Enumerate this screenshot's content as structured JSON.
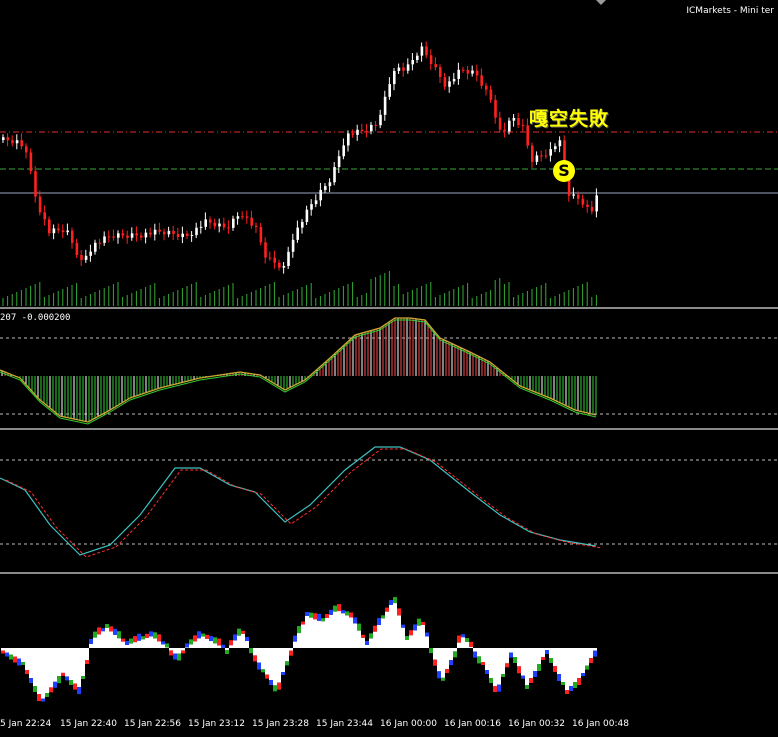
{
  "window": {
    "broker_label": "ICMarkets - Mini ter"
  },
  "indicator": {
    "macd_label": "207 -0.000200"
  },
  "annotation": {
    "text": "嘎空失敗",
    "signal_letter": "S"
  },
  "colors": {
    "background": "#000000",
    "bull_candle": "#ffffff",
    "bear_candle": "#ff2020",
    "volume": "#33aa33",
    "resistance": "#e03030",
    "support": "#3aa53a",
    "current": "#9aa6c0",
    "macd_signal": "#ccaa33",
    "macd_line": "#33cc33",
    "osc_fast": "#40c0c0",
    "osc_slow": "#ff3030",
    "annotation": "#ffff00"
  },
  "xaxis": {
    "labels": [
      "5 Jan 22:24",
      "15 Jan 22:40",
      "15 Jan 22:56",
      "15 Jan 23:12",
      "15 Jan 23:28",
      "15 Jan 23:44",
      "16 Jan 00:00",
      "16 Jan 00:16",
      "16 Jan 00:32",
      "16 Jan 00:48"
    ]
  }
}
